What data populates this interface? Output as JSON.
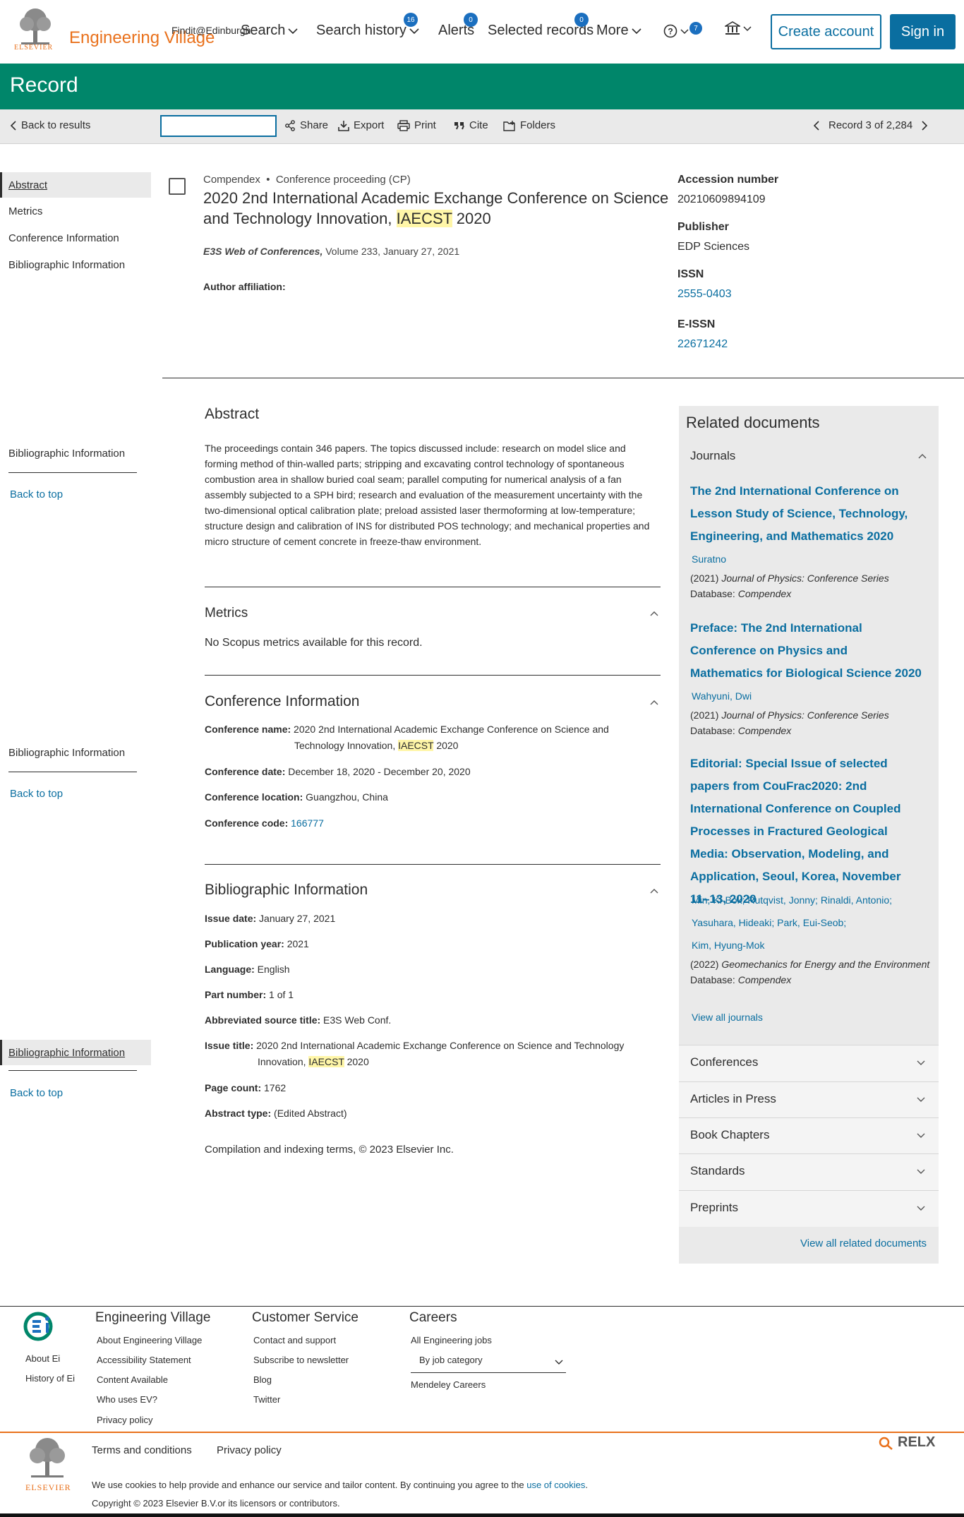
{
  "header": {
    "brand": "ELSEVIER",
    "product": "Engineering Village",
    "nav": {
      "search": "Search",
      "search_history": "Search history",
      "search_history_count": "16",
      "alerts": "Alerts",
      "alerts_count": "0",
      "selected_records": "Selected records",
      "selected_records_count": "0",
      "more": "More",
      "help_count": "7"
    },
    "create_account": "Create account",
    "sign_in": "Sign in",
    "accent_color": "#0a6ea0",
    "brand_color": "#e9711c"
  },
  "record_bar": {
    "title": "Record",
    "color": "#00866a"
  },
  "toolbar": {
    "back": "Back to results",
    "findit": "Findit@Edinburgh",
    "share": "Share",
    "export": "Export",
    "print": "Print",
    "cite": "Cite",
    "folders": "Folders",
    "pager": "Record 3 of 2,284"
  },
  "left_nav": {
    "items": [
      "Abstract",
      "Metrics",
      "Conference Information",
      "Bibliographic Information"
    ],
    "bib_info": "Bibliographic Information",
    "back_to_top": "Back to top"
  },
  "record": {
    "database": "Compendex",
    "doc_type": "Conference proceeding (CP)",
    "title_part1": "2020 2nd International Academic Exchange Conference on Science and Technology Innovation,",
    "title_highlight": "IAECST",
    "title_part2": "2020",
    "source_name": "E3S Web of Conferences,",
    "source_rest": "Volume 233, January 27, 2021",
    "author_affiliation_label": "Author affiliation:"
  },
  "record_meta": {
    "accession_label": "Accession number",
    "accession_value": "20210609894109",
    "publisher_label": "Publisher",
    "publisher_value": "EDP Sciences",
    "issn_label": "ISSN",
    "issn_value": "2555-0403",
    "eissn_label": "E-ISSN",
    "eissn_value": "22671242"
  },
  "abstract": {
    "heading": "Abstract",
    "text": "The proceedings contain 346 papers. The topics discussed include: research on model slice and forming method of thin-walled parts; stripping and excavating control technology of spontaneous combustion area in shallow buried coal seam; parallel computing for numerical analysis of a fan assembly subjected to a SPH bird; research and evaluation of the measurement uncertainty with the two-dimensional optical calibration plate; preload assisted laser thermoforming at low-temperature; structure design and calibration of INS for distributed POS technology; and mechanical properties and micro structure of cement concrete in freeze-thaw environment."
  },
  "metrics": {
    "heading": "Metrics",
    "text": "No Scopus metrics available for this record."
  },
  "conference": {
    "heading": "Conference Information",
    "name_label": "Conference name:",
    "name_part1": "2020 2nd International Academic Exchange Conference on Science and",
    "name_part2": "Technology Innovation,",
    "name_highlight": "IAECST",
    "name_part3": "2020",
    "date_label": "Conference date:",
    "date_value": "December 18, 2020 - December 20, 2020",
    "location_label": "Conference location:",
    "location_value": "Guangzhou, China",
    "code_label": "Conference code:",
    "code_value": "166777"
  },
  "bibliographic": {
    "heading": "Bibliographic Information",
    "issue_date_label": "Issue date:",
    "issue_date_value": "January 27, 2021",
    "pub_year_label": "Publication year:",
    "pub_year_value": "2021",
    "language_label": "Language:",
    "language_value": "English",
    "part_number_label": "Part number:",
    "part_number_value": "1 of 1",
    "abbr_label": "Abbreviated source title:",
    "abbr_value": "E3S Web Conf.",
    "issue_title_label": "Issue title:",
    "issue_title_part1": "2020 2nd International Academic Exchange Conference on Science and Technology",
    "issue_title_part2": "Innovation,",
    "issue_title_highlight": "IAECST",
    "issue_title_part3": "2020",
    "page_count_label": "Page count:",
    "page_count_value": "1762",
    "abstract_type_label": "Abstract type:",
    "abstract_type_value": "(Edited Abstract)",
    "compilation": "Compilation and indexing terms, © 2023 Elsevier Inc."
  },
  "related": {
    "heading": "Related documents",
    "journals": "Journals",
    "docs": [
      {
        "title": "The 2nd International Conference on Lesson Study of Science, Technology, Engineering, and Mathematics 2020",
        "authors": "Suratno",
        "year": "(2021)",
        "journal": "Journal of Physics: Conference Series",
        "db_label": "Database:",
        "db": "Compendex"
      },
      {
        "title": "Preface: The 2nd International Conference on Physics and Mathematics for Biological Science 2020",
        "authors": "Wahyuni, Dwi",
        "year": "(2021)",
        "journal": "Journal of Physics: Conference Series",
        "db_label": "Database:",
        "db": "Compendex"
      },
      {
        "title": "Editorial: Special Issue of selected papers from CouFrac2020: 2nd International Conference on Coupled Processes in Fractured Geological Media: Observation, Modeling, and Application, Seoul, Korea, November 11–13, 2020",
        "authors_line1": "Min, Ki-Bok; Rutqvist, Jonny; Rinaldi, Antonio;",
        "authors_line2": "Yasuhara, Hideaki; Park, Eui-Seob;",
        "authors_line3": "Kim, Hyung-Mok",
        "year": "(2022)",
        "journal": "Geomechanics for Energy and the Environment",
        "db_label": "Database:",
        "db": "Compendex"
      }
    ],
    "view_all_journals": "View all journals",
    "categories": [
      "Conferences",
      "Articles in Press",
      "Book Chapters",
      "Standards",
      "Preprints"
    ],
    "view_all": "View all related documents"
  },
  "footer": {
    "about_ei": "About Ei",
    "history_ei": "History of Ei",
    "col1_title": "Engineering Village",
    "col1_links": [
      "About Engineering Village",
      "Accessibility Statement",
      "Content Available",
      "Who uses EV?",
      "Privacy policy"
    ],
    "col2_title": "Customer Service",
    "col2_links": [
      "Contact and support",
      "Subscribe to newsletter",
      "Blog",
      "Twitter"
    ],
    "col3_title": "Careers",
    "col3_link1": "All Engineering jobs",
    "col3_select": "By job category",
    "col3_link2": "Mendeley Careers",
    "terms": "Terms and conditions",
    "privacy": "Privacy policy",
    "relx": "RELX",
    "cookie_text": "We use cookies to help provide and enhance our service and tailor content. By continuing you agree to the",
    "cookie_link": "use of cookies",
    "copyright": "Copyright © 2023 Elsevier B.V.or its licensors or contributors."
  }
}
